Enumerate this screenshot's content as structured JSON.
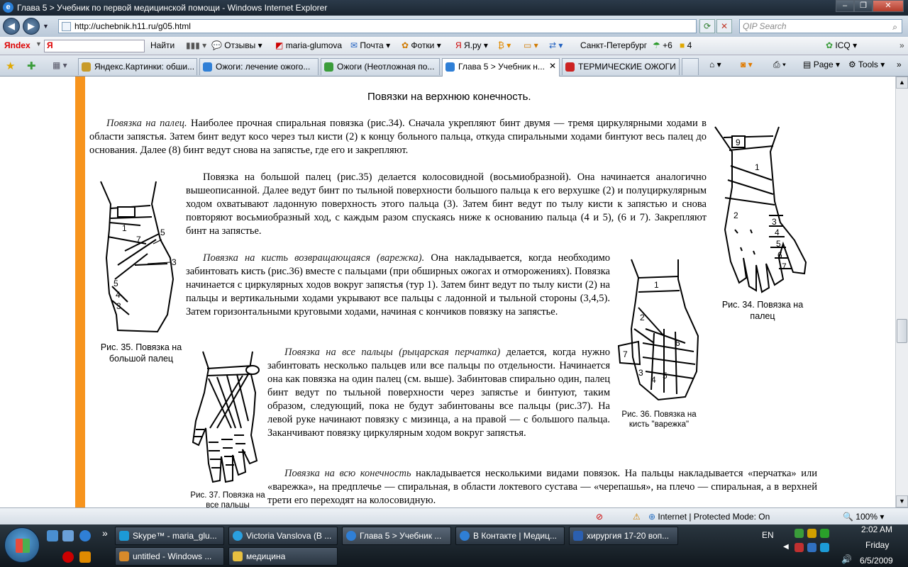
{
  "window": {
    "title": "Глава 5 > Учебник по первой медицинской помощи - Windows Internet Explorer"
  },
  "address": {
    "url": "http://uchebnik.h11.ru/g05.html",
    "qip_placeholder": "QIP Search"
  },
  "yandex_bar": {
    "logo": "Яndex",
    "items": [
      "Найти",
      "Отзывы",
      "maria-glumova",
      "Почта",
      "Фотки",
      "Я.ру",
      "Санкт-Петербург",
      "+6",
      "4",
      "ICQ"
    ]
  },
  "tabs": [
    {
      "label": "Яндекс.Картинки: обши...",
      "active": false,
      "icon_color": "#c89b2a"
    },
    {
      "label": "Ожоги: лечение ожого...",
      "active": false,
      "icon_color": "#2f7fd6"
    },
    {
      "label": "Ожоги (Неотложная по...",
      "active": false,
      "icon_color": "#3a9c3a"
    },
    {
      "label": "Глава 5 > Учебник н...",
      "active": true,
      "icon_color": "#2f7fd6"
    },
    {
      "label": "ТЕРМИЧЕСКИЕ ОЖОГИ ...",
      "active": false,
      "icon_color": "#cc2222"
    }
  ],
  "toolbar_right": {
    "page": "Page",
    "tools": "Tools"
  },
  "content": {
    "heading": "Повязки на верхнюю конечность.",
    "p1_lead": "Повязка на палец.",
    "p1": " Наиболее прочная спиральная повязка (рис.34). Сначала укрепляют бинт двумя — тремя циркулярными ходами в области запястья. Затем бинт ведут косо через тыл кисти (2) к концу больного пальца, откуда спиральными ходами бинтуют весь палец до основания. Далее (8) бинт ведут снова на запястье, где его и закрепляют.",
    "p2": "Повязка на большой палец (рис.35) делается колосовидной (восьмиобразной). Она начинается аналогично вышеописанной. Далее ведут бинт по тыльной поверхности большого пальца к его верхушке (2) и полуциркулярным ходом охватывают ладонную поверхность этого пальца (3). Затем бинт ведут по тылу кисти к запястью и снова повторяют восьмиобразный ход, с каждым разом спускаясь ниже к основанию пальца (4 и 5), (6 и 7). Закрепляют бинт на запястье.",
    "p3_lead": "Повязка на кисть возвращающаяся (варежка).",
    "p3": " Она накладывается, когда необходимо забинтовать кисть (рис.36) вместе с пальцами (при обширных ожогах и отморожениях). Повязка начинается с циркулярных ходов вокруг запястья (тур 1). Затем бинт ведут по тылу кисти (2) на пальцы и вертикальными ходами укрывают все пальцы с ладонной и тыльной стороны (3,4,5). Затем горизонтальными круговыми ходами, начиная с кончиков повязку на запястье.",
    "p4_lead": "Повязка на все пальцы (рыцарская перчатка)",
    "p4": " делается, когда нужно забинтовать несколько пальцев или все пальцы по отдельности. Начинается она как повязка на один палец (см. выше). Забинтовав спирально один, палец бинт ведут по тыльной поверхности через запястье и бинтуют, таким образом, следующий, пока не будут забинтованы все пальцы (рис.37). На левой руке начинают повязку с мизинца, а на правой — с большого пальца. Заканчивают повязку циркулярным ходом вокруг запястья.",
    "p5_lead": "Повязка на всю конечность",
    "p5": " накладывается несколькими видами повязок. На пальцы накладывается «перчатка» или «варежка», на предплечье — спиральная, в области локтевого сустава — «черепашья», на плечо — спиральная, а в верхней трети его переходят на колосовидную.",
    "cap34": "Рис. 34. Повязка на палец",
    "cap35": "Рис. 35. Повязка на большой палец",
    "cap36": "Рис. 36. Повязка на кисть \"варежка\"",
    "cap37": "Рис. 37. Повязка на все пальцы"
  },
  "figures": {
    "fig34_labels": [
      "9",
      "1",
      "2",
      "3",
      "4",
      "5",
      "6",
      "7"
    ],
    "fig35_labels": [
      "1",
      "7",
      "5",
      "3",
      "5",
      "4",
      "3"
    ],
    "fig36_labels": [
      "1",
      "2",
      "6",
      "7",
      "3",
      "4",
      "5"
    ]
  },
  "status": {
    "zone": "Internet | Protected Mode: On",
    "zoom": "100%"
  },
  "taskbar": {
    "buttons_row1": [
      "Skype™ - maria_glu...",
      "Victoria Vanslova (В ...",
      "Глава 5 > Учебник ...",
      "В Контакте | Медиц...",
      "хирургия 17-20 воп..."
    ],
    "buttons_row2": [
      "untitled - Windows ...",
      "медицина"
    ],
    "lang": "EN",
    "time": "2:02 AM",
    "day": "Friday",
    "date": "6/5/2009"
  }
}
